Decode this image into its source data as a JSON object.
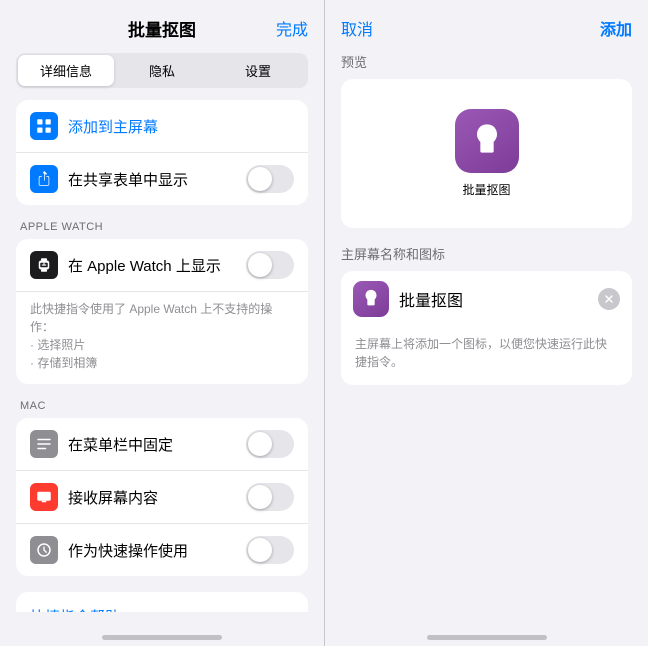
{
  "left": {
    "title": "批量抠图",
    "done_label": "完成",
    "tabs": [
      {
        "label": "详细信息",
        "active": true
      },
      {
        "label": "隐私",
        "active": false
      },
      {
        "label": "设置",
        "active": false
      }
    ],
    "rows": [
      {
        "id": "add-home",
        "icon_type": "blue-grid",
        "text": "添加到主屏幕",
        "blue": true,
        "toggle": false
      },
      {
        "id": "share-show",
        "icon_type": "share",
        "text": "在共享表单中显示",
        "blue": false,
        "toggle": true
      }
    ],
    "apple_watch_section_label": "APPLE WATCH",
    "apple_watch_row": {
      "text": "在 Apple Watch 上显示",
      "toggle": true
    },
    "apple_watch_note": "此快捷指令使用了 Apple Watch 上不支持的操作：\n· 选择照片\n· 存储到相簿",
    "mac_section_label": "MAC",
    "mac_rows": [
      {
        "text": "在菜单栏中固定",
        "toggle": true
      },
      {
        "text": "接收屏幕内容",
        "toggle": true
      },
      {
        "text": "作为快速操作使用",
        "toggle": true
      }
    ],
    "help_label": "快捷指令帮助"
  },
  "right": {
    "cancel_label": "取消",
    "add_label": "添加",
    "preview_label": "预览",
    "app_name": "批量抠图",
    "homescreen_section_label": "主屏幕名称和图标",
    "homescreen_name": "批量抠图",
    "homescreen_desc": "主屏幕上将添加一个图标，以便您快速运行此快捷指令。"
  }
}
